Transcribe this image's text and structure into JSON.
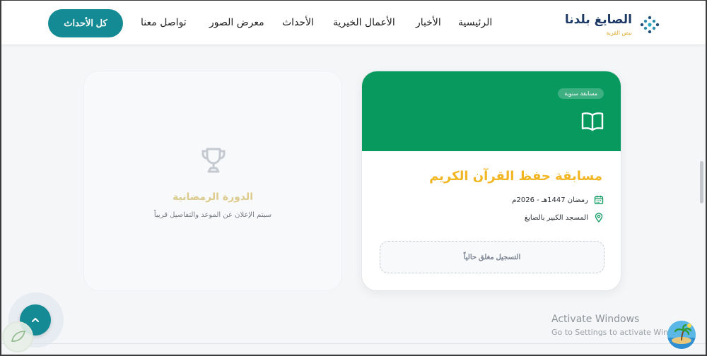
{
  "header": {
    "cta_label": "كل الأحداث",
    "nav": [
      {
        "label": "الرئيسية"
      },
      {
        "label": "الأخبار"
      },
      {
        "label": "الأعمال الخيرية"
      },
      {
        "label": "الأحداث"
      },
      {
        "label": "معرض الصور"
      },
      {
        "label": "تواصل معنا"
      }
    ],
    "logo": {
      "title": "الصايغ بلدنا",
      "subtitle": "نبض القرية"
    }
  },
  "placeholder_card": {
    "icon": "trophy-icon",
    "title": "الدورة الرمضانية",
    "text": "سيتم الإعلان عن الموعد والتفاصيل قريباً"
  },
  "event_card": {
    "badge": "مسابقة سنوية",
    "icon": "open-book-icon",
    "title": "مسابقة حفظ القرآن الكريم",
    "date": "رمضان 1447هـ - 2026م",
    "location": "المسجد الكبير بالصايغ",
    "register_label": "التسجيل مغلق حالياً",
    "banner_color": "#07995e",
    "title_color": "#f2b624"
  },
  "colors": {
    "accent": "#138a94",
    "background": "#f4f6f8"
  },
  "watermark": {
    "line1": "Activate Windows",
    "line2": "Go to Settings to activate Windo"
  }
}
